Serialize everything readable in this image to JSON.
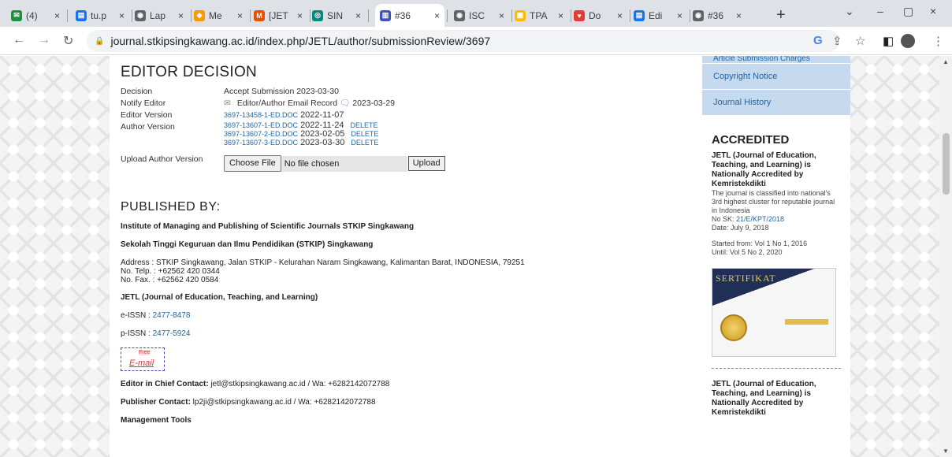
{
  "browser": {
    "tabs": [
      {
        "label": "(4)",
        "fav": "#1e8e3e",
        "glyph": "✉"
      },
      {
        "label": "tu.p",
        "fav": "#1a73e8",
        "glyph": "▤"
      },
      {
        "label": "Lap",
        "fav": "#5f6368",
        "glyph": "◉"
      },
      {
        "label": "Me",
        "fav": "#ff9800",
        "glyph": "◆"
      },
      {
        "label": "[JET",
        "fav": "#e65100",
        "glyph": "M"
      },
      {
        "label": "SIN",
        "fav": "#00897b",
        "glyph": "◎"
      },
      {
        "label": "#36",
        "fav": "#3f51b5",
        "glyph": "▥",
        "active": true
      },
      {
        "label": "ISC",
        "fav": "#5f6368",
        "glyph": "◉"
      },
      {
        "label": "TPA",
        "fav": "#fbbc04",
        "glyph": "▣"
      },
      {
        "label": "Do",
        "fav": "#e53935",
        "glyph": "♥"
      },
      {
        "label": "Edi",
        "fav": "#1a73e8",
        "glyph": "▤"
      },
      {
        "label": "#36",
        "fav": "#5f6368",
        "glyph": "◉"
      }
    ],
    "new_tab": "+",
    "close_glyph": "×",
    "url": "journal.stkipsingkawang.ac.id/index.php/JETL/author/submissionReview/3697"
  },
  "editor": {
    "title": "EDITOR DECISION",
    "decision_label": "Decision",
    "decision_value": "Accept Submission 2023-03-30",
    "notify_label": "Notify Editor",
    "notify_value": "Editor/Author Email Record",
    "notify_date": "2023-03-29",
    "editor_version_label": "Editor Version",
    "editor_version_file": "3697-13458-1-ED.DOC",
    "editor_version_date": "2022-11-07",
    "author_version_label": "Author Version",
    "author_versions": [
      {
        "file": "3697-13607-1-ED.DOC",
        "date": "2022-11-24",
        "del": "DELETE"
      },
      {
        "file": "3697-13607-2-ED.DOC",
        "date": "2023-02-05",
        "del": "DELETE"
      },
      {
        "file": "3697-13607-3-ED.DOC",
        "date": "2023-03-30",
        "del": "DELETE"
      }
    ],
    "upload_label": "Upload Author Version",
    "choose_file": "Choose File",
    "no_file": "No file chosen",
    "upload_button": "Upload"
  },
  "published": {
    "title": "PUBLISHED BY:",
    "institute": "Institute of Managing and Publishing of Scientific Journals STKIP Singkawang",
    "school": "Sekolah Tinggi Keguruan dan Ilmu Pendidikan (STKIP) Singkawang",
    "address": "Address : STKIP Singkawang, Jalan STKIP - Kelurahan Naram Singkawang, Kalimantan Barat, INDONESIA, 79251",
    "telp": "No. Telp.  : +62562 420 0344",
    "fax": "No. Fax.   : +62562 420 0584",
    "journal": "JETL (Journal of  Education, Teaching, and Learning)",
    "eissn_label": "e-ISSN : ",
    "eissn": "2477-8478",
    "pissn_label": "p-ISSN : ",
    "pissn": "2477-5924",
    "email_badge_top": "Free",
    "email_badge": "E-mail",
    "chief_label": "Editor in Chief Contact:",
    "chief_value": " jetl@stkipsingkawang.ac.id / Wa: +6282142072788",
    "publisher_label": "Publisher Contact:",
    "publisher_value": " lp2ji@stkipsingkawang.ac.id / Wa: +6282142072788",
    "tools": "Management Tools"
  },
  "sidebar": {
    "nav": [
      "Article Submission Charges",
      "Copyright Notice",
      "Journal History"
    ],
    "acc_title": "ACCREDITED",
    "acc_bold": "JETL (Journal of Education, Teaching, and Learning) is Nationally Accredited by Kemristekdikti",
    "acc_text": "The journal is classified into national's 3rd highest cluster for reputable journal in Indonesia",
    "sk_label": "No SK: ",
    "sk": "21/E/KPT/2018",
    "date": "Date: July 9, 2018",
    "started": "Started from: Vol 1 No 1, 2016",
    "until": "Until: Vol 5 No 2, 2020",
    "cert_title": "SERTIFIKAT",
    "acc_bold2": "JETL (Journal of Education, Teaching, and Learning) is Nationally Accredited by Kemristekdikti"
  }
}
